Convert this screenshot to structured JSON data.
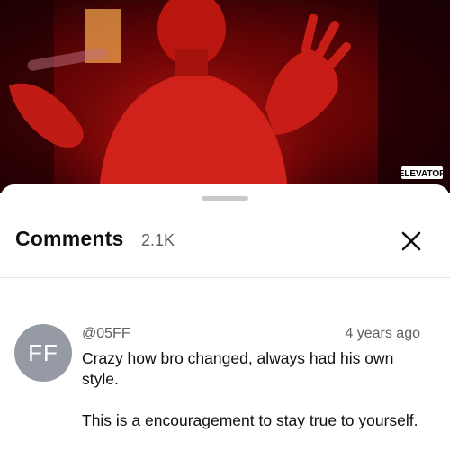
{
  "video": {
    "watermark_text": "ELEVATOR",
    "tint_color": "#b3100c"
  },
  "comments_panel": {
    "title": "Comments",
    "count": "2.1K",
    "close_icon": "close-icon"
  },
  "comments": [
    {
      "avatar_initials": "FF",
      "author": "@05FF",
      "time": "4 years ago",
      "paragraphs": [
        "Crazy how bro changed, always had his own style.",
        "This is a encouragement to stay true to yourself."
      ]
    }
  ]
}
